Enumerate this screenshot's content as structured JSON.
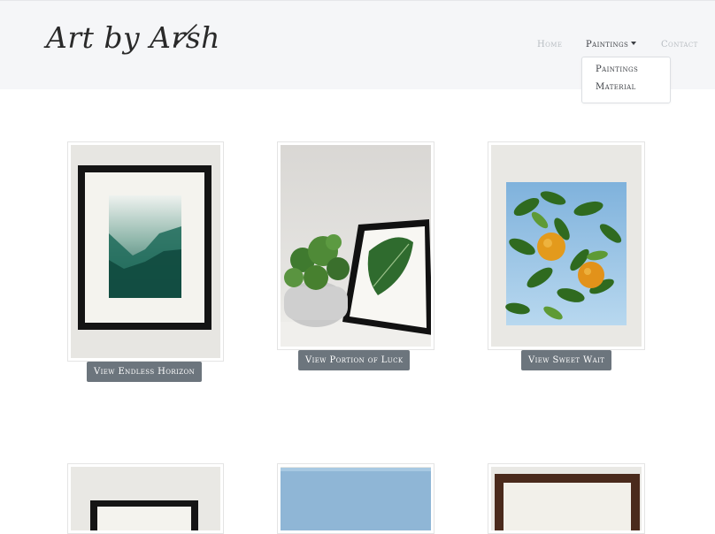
{
  "brand": {
    "logo_text": "Art by Arsh"
  },
  "nav": {
    "home": "Home",
    "paintings": "Paintings",
    "contact": "Contact"
  },
  "dropdown": {
    "items": [
      "Paintings",
      "Material"
    ]
  },
  "gallery": {
    "items": [
      {
        "button": "View Endless Horizon",
        "subject": "framed misty green forest painting"
      },
      {
        "button": "View Portion of Luck",
        "subject": "framed leaf painting beside potted plant"
      },
      {
        "button": "View Sweet Wait",
        "subject": "oranges on branch painting on canvas"
      }
    ],
    "second_row_visible": 3
  },
  "colors": {
    "navbar_bg": "#f5f6f8",
    "button_bg": "#6c757d",
    "muted_link": "#b7bcc1"
  }
}
